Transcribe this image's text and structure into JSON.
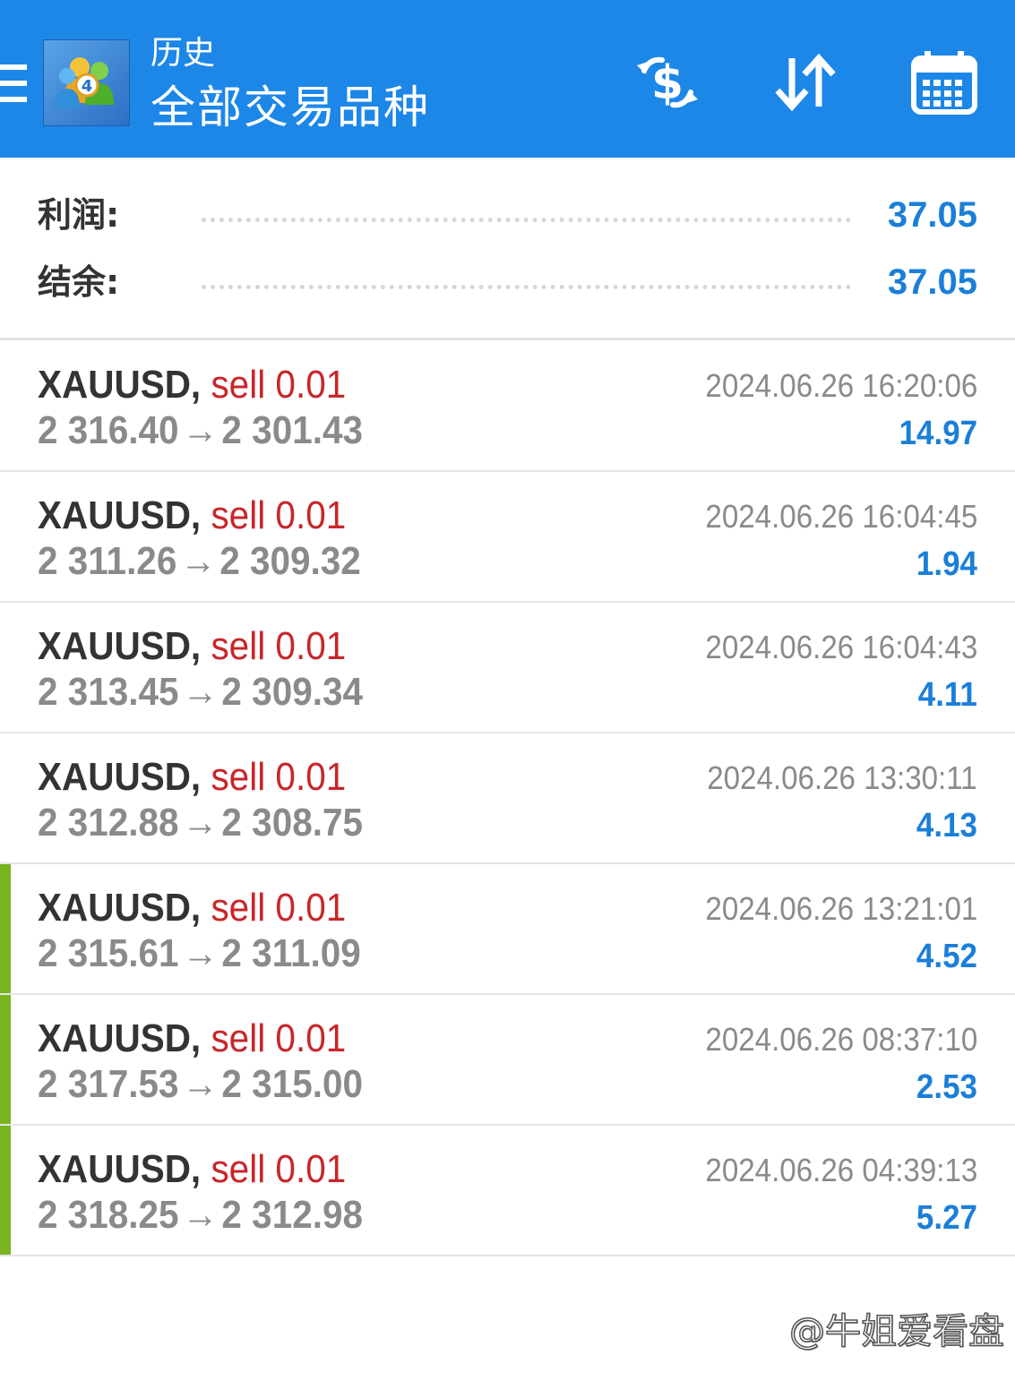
{
  "header": {
    "title": "历史",
    "subtitle": "全部交易品种",
    "logo_icon": "metatrader4-logo-icon",
    "menu_icon": "hamburger-menu-icon",
    "buttons": [
      {
        "icon": "currency-exchange-icon"
      },
      {
        "icon": "sort-arrows-icon"
      },
      {
        "icon": "calendar-icon"
      }
    ],
    "background_color": "#1d87e8"
  },
  "summary": {
    "profit_label": "利润:",
    "profit_value": "37.05",
    "balance_label": "结余:",
    "balance_value": "37.05"
  },
  "trades": [
    {
      "symbol": "XAUUSD,",
      "side": "sell 0.01",
      "open_price": "2 316.40",
      "close_price": "2 301.43",
      "arrow": "→",
      "time": "2024.06.26 16:20:06",
      "profit": "14.97",
      "marker": false
    },
    {
      "symbol": "XAUUSD,",
      "side": "sell 0.01",
      "open_price": "2 311.26",
      "close_price": "2 309.32",
      "arrow": "→",
      "time": "2024.06.26 16:04:45",
      "profit": "1.94",
      "marker": false
    },
    {
      "symbol": "XAUUSD,",
      "side": "sell 0.01",
      "open_price": "2 313.45",
      "close_price": "2 309.34",
      "arrow": "→",
      "time": "2024.06.26 16:04:43",
      "profit": "4.11",
      "marker": false
    },
    {
      "symbol": "XAUUSD,",
      "side": "sell 0.01",
      "open_price": "2 312.88",
      "close_price": "2 308.75",
      "arrow": "→",
      "time": "2024.06.26 13:30:11",
      "profit": "4.13",
      "marker": false
    },
    {
      "symbol": "XAUUSD,",
      "side": "sell 0.01",
      "open_price": "2 315.61",
      "close_price": "2 311.09",
      "arrow": "→",
      "time": "2024.06.26 13:21:01",
      "profit": "4.52",
      "marker": true
    },
    {
      "symbol": "XAUUSD,",
      "side": "sell 0.01",
      "open_price": "2 317.53",
      "close_price": "2 315.00",
      "arrow": "→",
      "time": "2024.06.26 08:37:10",
      "profit": "2.53",
      "marker": true
    },
    {
      "symbol": "XAUUSD,",
      "side": "sell 0.01",
      "open_price": "2 318.25",
      "close_price": "2 312.98",
      "arrow": "→",
      "time": "2024.06.26 04:39:13",
      "profit": "5.27",
      "marker": true
    }
  ],
  "colors": {
    "symbol": "#333333",
    "sell": "#c8262a",
    "price": "#8a8a8a",
    "profit": "#1b7fd8",
    "marker": "#79b320"
  },
  "watermark": "@牛姐爱看盘"
}
